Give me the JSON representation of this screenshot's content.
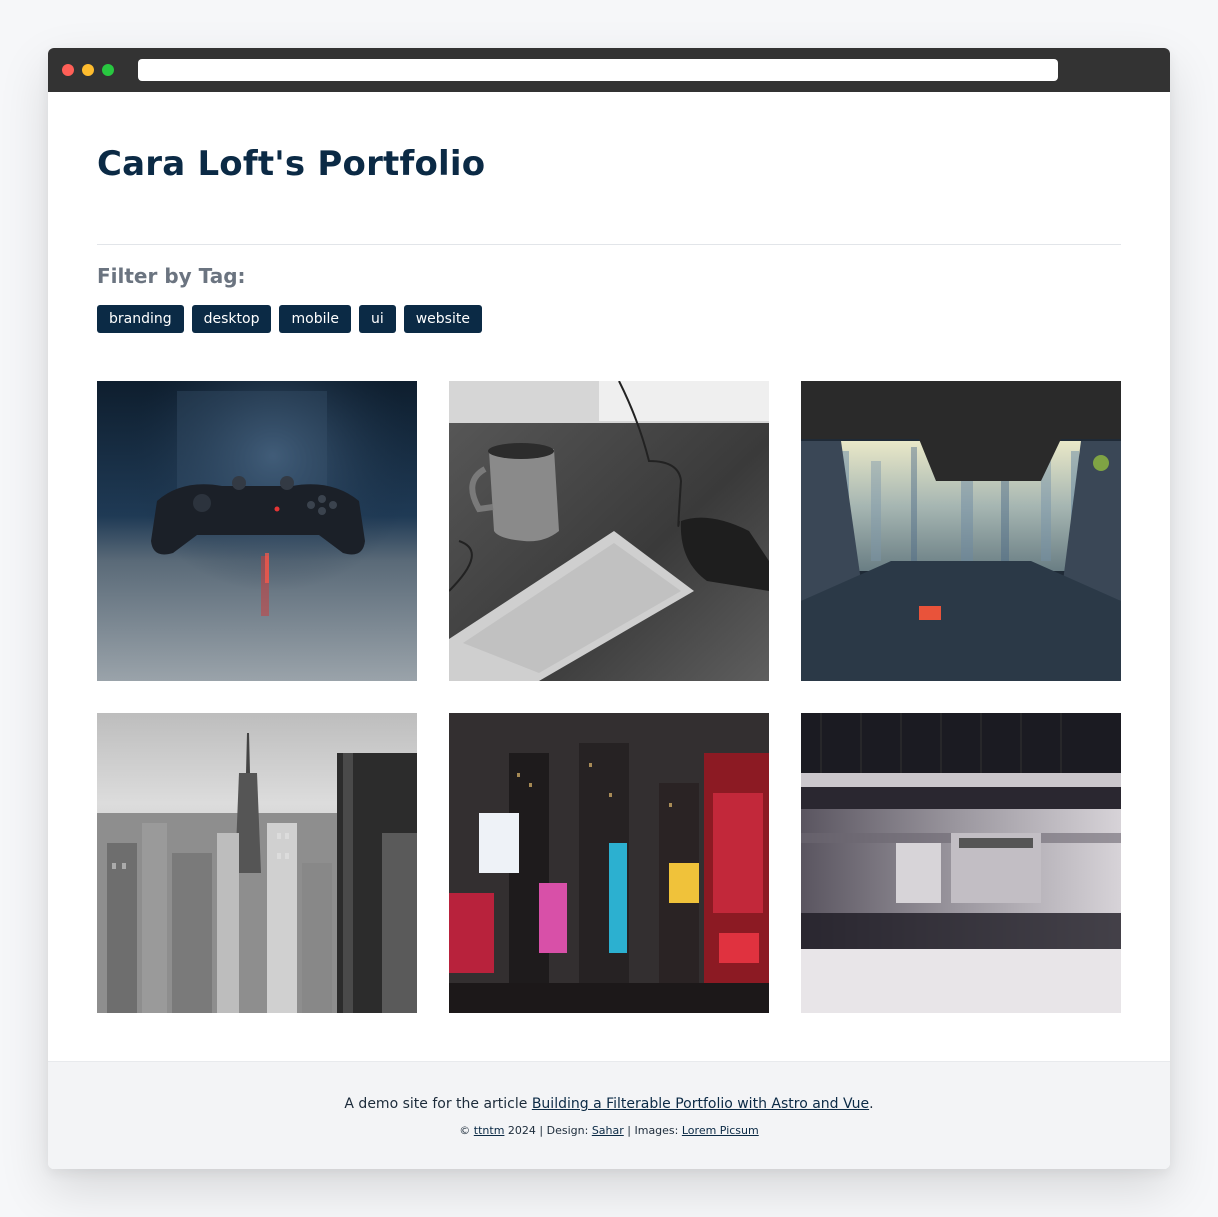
{
  "page": {
    "title": "Cara Loft's Portfolio",
    "filter_heading": "Filter by Tag:"
  },
  "tags": [
    {
      "label": "branding"
    },
    {
      "label": "desktop"
    },
    {
      "label": "mobile"
    },
    {
      "label": "ui"
    },
    {
      "label": "website"
    }
  ],
  "gallery": [
    {
      "subject": "game-controller"
    },
    {
      "subject": "mug-and-keyboard"
    },
    {
      "subject": "city-through-gap"
    },
    {
      "subject": "city-skyline"
    },
    {
      "subject": "times-square-night"
    },
    {
      "subject": "subway-train-motion"
    }
  ],
  "footer": {
    "line1_prefix": "A demo site for the article ",
    "article_link": "Building a Filterable Portfolio with Astro and Vue",
    "line1_suffix": ".",
    "copyright_symbol": "©",
    "author_link": "ttntm",
    "year_design": "2024 | Design:",
    "designer_link": "Sahar",
    "images_label": "| Images:",
    "images_link": "Lorem Picsum"
  },
  "colors": {
    "brand_dark": "#0b2a45",
    "heading_muted": "#6b7480",
    "window_bar": "#333333"
  }
}
